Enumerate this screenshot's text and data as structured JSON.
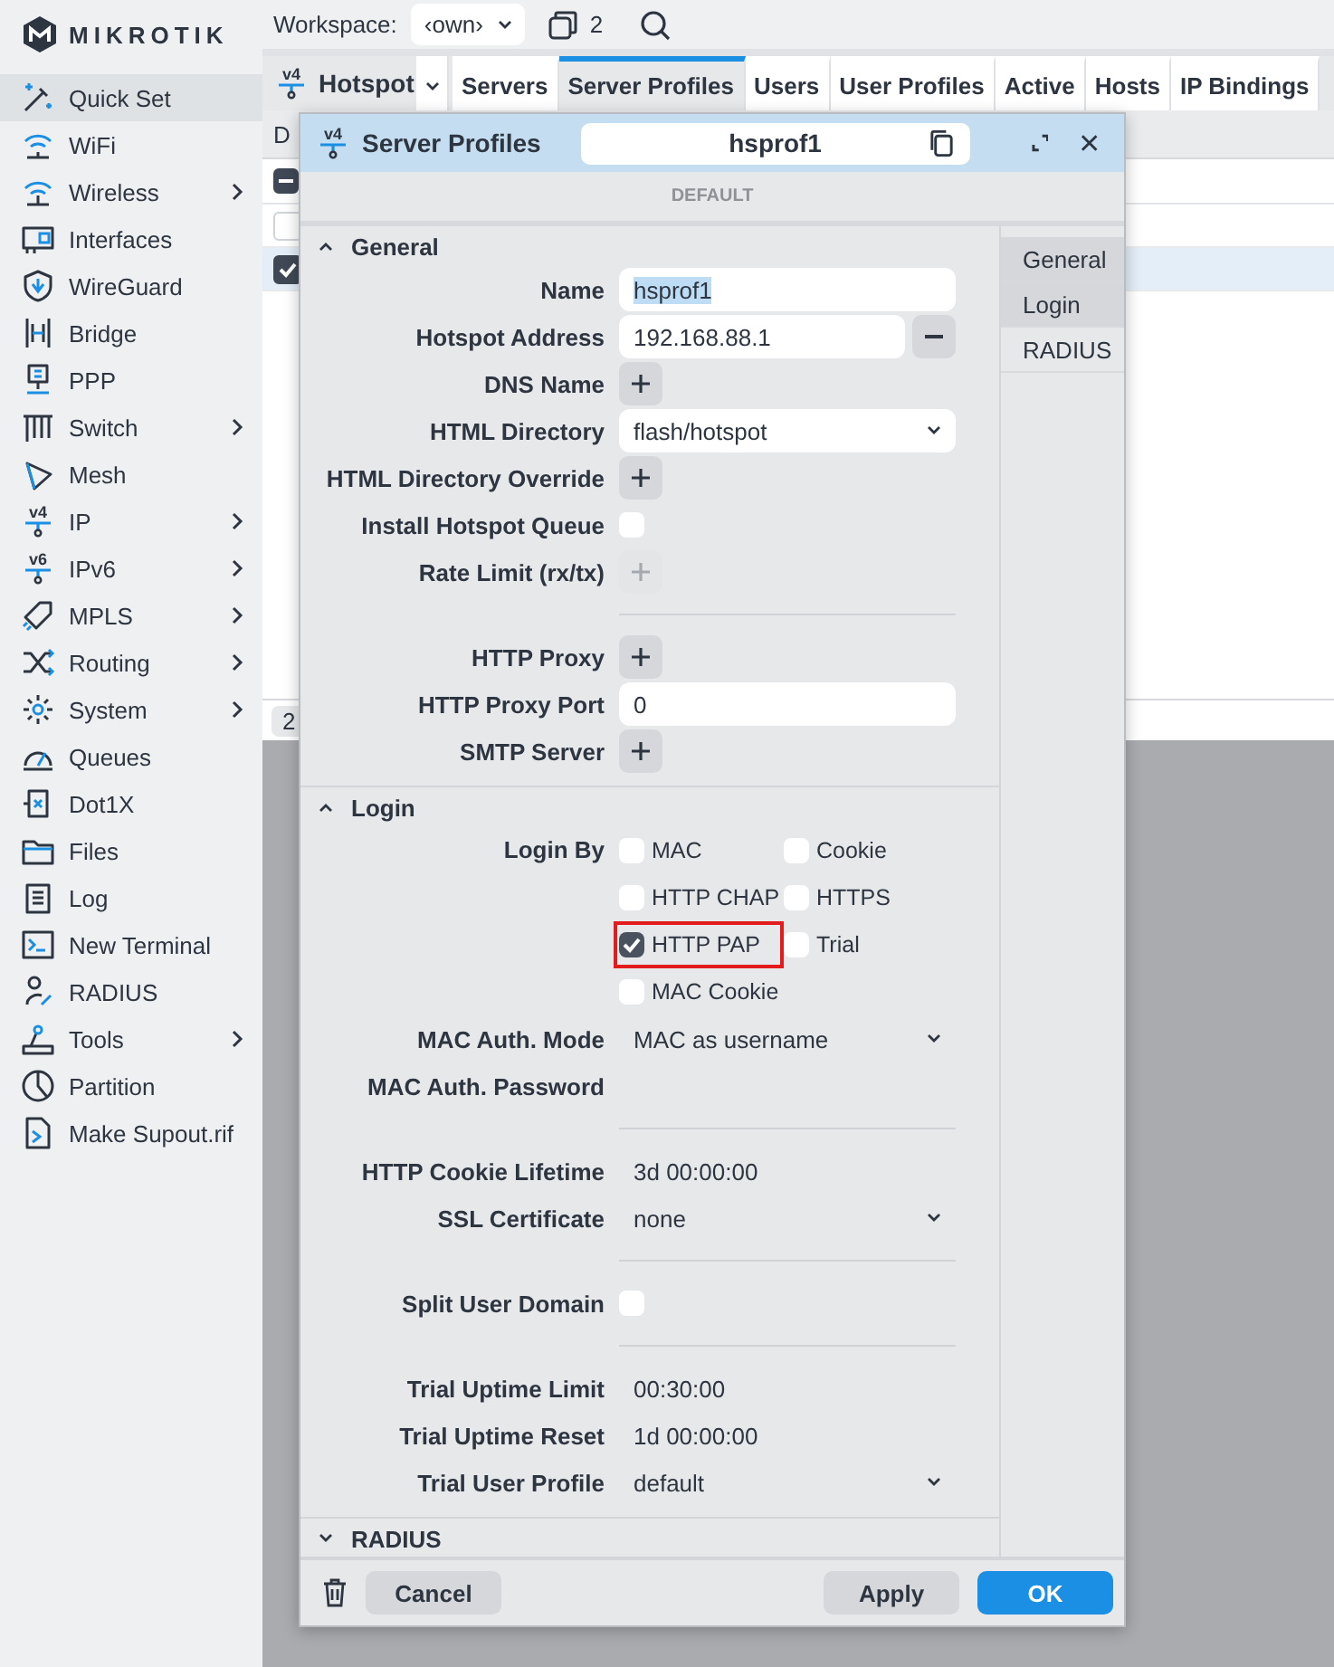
{
  "brand": {
    "name": "MIKROTIK"
  },
  "sidebar": {
    "items": [
      {
        "label": "Quick Set",
        "selected": true,
        "submenu": false
      },
      {
        "label": "WiFi",
        "selected": false,
        "submenu": false
      },
      {
        "label": "Wireless",
        "selected": false,
        "submenu": true
      },
      {
        "label": "Interfaces",
        "selected": false,
        "submenu": false
      },
      {
        "label": "WireGuard",
        "selected": false,
        "submenu": false
      },
      {
        "label": "Bridge",
        "selected": false,
        "submenu": false
      },
      {
        "label": "PPP",
        "selected": false,
        "submenu": false
      },
      {
        "label": "Switch",
        "selected": false,
        "submenu": true
      },
      {
        "label": "Mesh",
        "selected": false,
        "submenu": false
      },
      {
        "label": "IP",
        "selected": false,
        "submenu": true,
        "badge": "v4"
      },
      {
        "label": "IPv6",
        "selected": false,
        "submenu": true,
        "badge": "v6"
      },
      {
        "label": "MPLS",
        "selected": false,
        "submenu": true
      },
      {
        "label": "Routing",
        "selected": false,
        "submenu": true
      },
      {
        "label": "System",
        "selected": false,
        "submenu": true
      },
      {
        "label": "Queues",
        "selected": false,
        "submenu": false
      },
      {
        "label": "Dot1X",
        "selected": false,
        "submenu": false
      },
      {
        "label": "Files",
        "selected": false,
        "submenu": false
      },
      {
        "label": "Log",
        "selected": false,
        "submenu": false
      },
      {
        "label": "New Terminal",
        "selected": false,
        "submenu": false
      },
      {
        "label": "RADIUS",
        "selected": false,
        "submenu": false
      },
      {
        "label": "Tools",
        "selected": false,
        "submenu": true
      },
      {
        "label": "Partition",
        "selected": false,
        "submenu": false
      },
      {
        "label": "Make Supout.rif",
        "selected": false,
        "submenu": false
      }
    ]
  },
  "toolbar": {
    "workspace_label": "Workspace:",
    "workspace": "‹own›",
    "windows_count": "2"
  },
  "window": {
    "badge": "v4",
    "title": "Hotspot",
    "tabs": [
      {
        "label": "Servers",
        "selected": false
      },
      {
        "label": "Server Profiles",
        "selected": true
      },
      {
        "label": "Users",
        "selected": false
      },
      {
        "label": "User Profiles",
        "selected": false
      },
      {
        "label": "Active",
        "selected": false
      },
      {
        "label": "Hosts",
        "selected": false
      },
      {
        "label": "IP Bindings",
        "selected": false
      }
    ],
    "action": "D",
    "select_all_partial": true,
    "rows": [
      {
        "checked": false,
        "selected": false
      },
      {
        "checked": true,
        "selected": true
      }
    ],
    "count": "2"
  },
  "dialog": {
    "badge": "v4",
    "title": "Server Profiles",
    "name": "hsprof1",
    "banner": "DEFAULT",
    "nav": [
      {
        "label": "General",
        "selected": true
      },
      {
        "label": "Login",
        "selected": true
      },
      {
        "label": "RADIUS",
        "selected": false
      }
    ],
    "sections": [
      {
        "title": "General",
        "expanded": true,
        "rows": [
          {
            "kind": "text",
            "label": "Name",
            "value": "hsprof1",
            "text_selected": true
          },
          {
            "kind": "text",
            "label": "Hotspot Address",
            "value": "192.168.88.1",
            "removable": true
          },
          {
            "kind": "add",
            "label": "DNS Name",
            "disabled": false
          },
          {
            "kind": "select",
            "label": "HTML Directory",
            "value": "flash/hotspot",
            "boxed": true
          },
          {
            "kind": "add",
            "label": "HTML Directory Override",
            "disabled": false
          },
          {
            "kind": "checkbox",
            "label": "Install Hotspot Queue",
            "checked": false
          },
          {
            "kind": "add",
            "label": "Rate Limit (rx/tx)",
            "disabled": true
          },
          {
            "kind": "separator"
          },
          {
            "kind": "add",
            "label": "HTTP Proxy",
            "disabled": false
          },
          {
            "kind": "text",
            "label": "HTTP Proxy Port",
            "value": "0"
          },
          {
            "kind": "add",
            "label": "SMTP Server",
            "disabled": false
          }
        ]
      },
      {
        "title": "Login",
        "expanded": true,
        "rows": [
          {
            "kind": "checks",
            "label": "Login By",
            "options": [
              {
                "label": "MAC",
                "checked": false,
                "highlighted": false
              },
              {
                "label": "Cookie",
                "checked": false,
                "highlighted": false
              },
              {
                "label": "HTTP CHAP",
                "checked": false,
                "highlighted": false
              },
              {
                "label": "HTTPS",
                "checked": false,
                "highlighted": false
              },
              {
                "label": "HTTP PAP",
                "checked": true,
                "highlighted": true
              },
              {
                "label": "Trial",
                "checked": false,
                "highlighted": false
              },
              {
                "label": "MAC Cookie",
                "checked": false,
                "highlighted": false
              }
            ]
          },
          {
            "kind": "select",
            "label": "MAC Auth. Mode",
            "value": "MAC as username",
            "boxed": false
          },
          {
            "kind": "plain",
            "label": "MAC Auth. Password"
          },
          {
            "kind": "separator"
          },
          {
            "kind": "plain",
            "label": "HTTP Cookie Lifetime",
            "value": "3d 00:00:00"
          },
          {
            "kind": "select",
            "label": "SSL Certificate",
            "value": "none",
            "boxed": false
          },
          {
            "kind": "separator"
          },
          {
            "kind": "checkbox",
            "label": "Split User Domain",
            "checked": false
          },
          {
            "kind": "separator"
          },
          {
            "kind": "plain",
            "label": "Trial Uptime Limit",
            "value": "00:30:00"
          },
          {
            "kind": "plain",
            "label": "Trial Uptime Reset",
            "value": "1d 00:00:00"
          },
          {
            "kind": "select",
            "label": "Trial User Profile",
            "value": "default",
            "boxed": false
          }
        ]
      },
      {
        "title": "RADIUS",
        "expanded": false
      }
    ],
    "buttons": {
      "cancel": "Cancel",
      "apply": "Apply",
      "ok": "OK"
    }
  }
}
